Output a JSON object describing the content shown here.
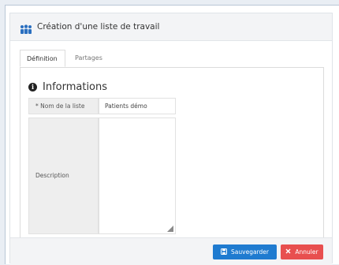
{
  "dialog": {
    "title": "Création d'une liste de travail",
    "header_icon": "users-icon"
  },
  "tabs": [
    {
      "label": "Définition",
      "active": true
    },
    {
      "label": "Partages",
      "active": false
    }
  ],
  "section": {
    "icon": "info-icon",
    "icon_glyph": "i",
    "title": "Informations"
  },
  "fields": {
    "name": {
      "label": "* Nom de la liste",
      "value": "Patients démo"
    },
    "description": {
      "label": "Description",
      "value": ""
    }
  },
  "footer": {
    "save_label": "Sauvegarder",
    "save_icon": "save-icon",
    "cancel_label": "Annuler",
    "cancel_icon": "close-icon"
  },
  "colors": {
    "save": "#1f7bd0",
    "cancel": "#e84f4f",
    "header_icon": "#2a6fc0"
  }
}
